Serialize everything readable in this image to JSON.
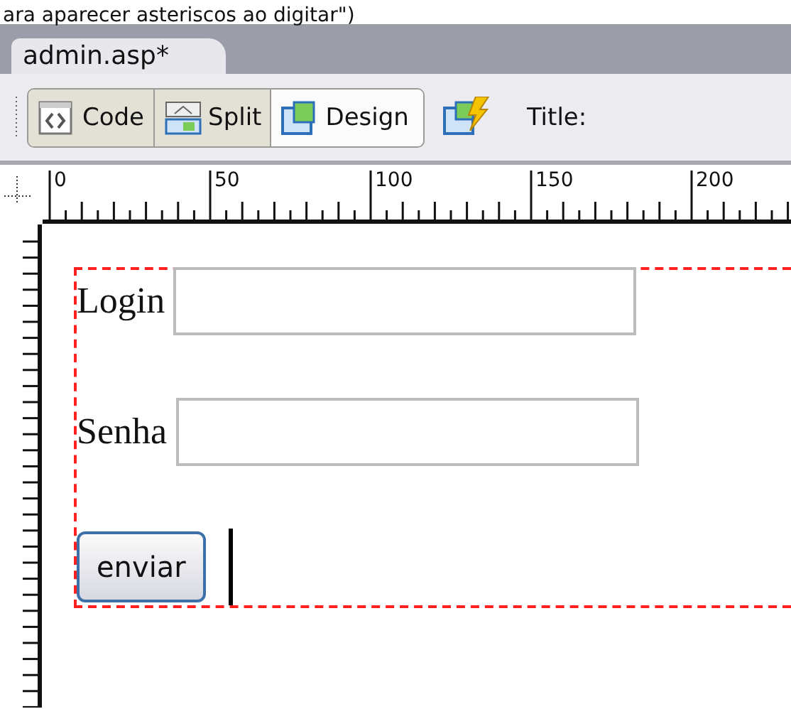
{
  "caption": "ara aparecer asteriscos ao digitar\")",
  "document_tab": {
    "label": "admin.asp*",
    "selected": true
  },
  "view_buttons": [
    {
      "kind": "code",
      "label": "Code",
      "selected": false
    },
    {
      "kind": "split",
      "label": "Split",
      "selected": false
    },
    {
      "kind": "design",
      "label": "Design",
      "selected": true
    }
  ],
  "title_label": "Title:",
  "ruler": {
    "labels": [
      "0",
      "50",
      "100",
      "150",
      "200"
    ]
  },
  "form": {
    "fields": [
      {
        "label": "Login"
      },
      {
        "label": "Senha"
      }
    ],
    "submit": "enviar"
  }
}
